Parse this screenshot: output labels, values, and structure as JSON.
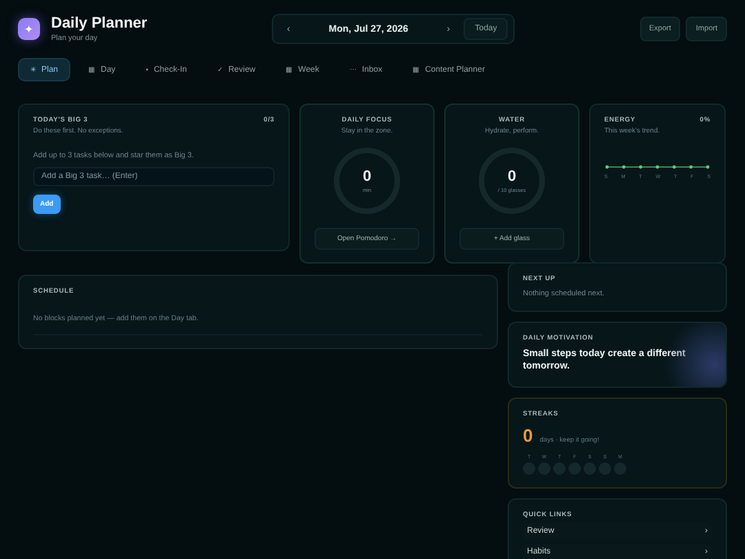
{
  "header": {
    "logo_glyph": "✦",
    "title": "Daily Planner",
    "subtitle": "Plan your day",
    "date_nav": {
      "prev": "‹",
      "date": "Mon, Jul 27, 2026",
      "next": "›",
      "today": "Today"
    },
    "actions": [
      "Export",
      "Import"
    ]
  },
  "tabs": [
    {
      "icon": "✳",
      "label": "Plan",
      "selected": true
    },
    {
      "icon": "▦",
      "label": "Day",
      "selected": false
    },
    {
      "icon": "•",
      "label": "Check-In",
      "selected": false
    },
    {
      "icon": "✓",
      "label": "Review",
      "selected": false
    },
    {
      "icon": "▦",
      "label": "Week",
      "selected": false
    },
    {
      "icon": "⋯",
      "label": "Inbox",
      "selected": false
    },
    {
      "icon": "▦",
      "label": "Content Planner",
      "selected": false
    }
  ],
  "big3": {
    "title": "TODAY'S BIG 3",
    "count": "0/3",
    "subtitle": "Do these first. No exceptions.",
    "hint": "Add up to 3 tasks below and star them as Big 3.",
    "input_placeholder": "Add a Big 3 task… (Enter)",
    "add_button": "Add"
  },
  "focus": {
    "title": "DAILY FOCUS",
    "subtitle": "Stay in the zone.",
    "value": "0",
    "unit": "min",
    "button": "Open Pomodoro →"
  },
  "water": {
    "title": "WATER",
    "subtitle": "Hydrate, perform.",
    "value": "0",
    "unit": "/ 10 glasses",
    "button": "+ Add glass"
  },
  "energy": {
    "title": "ENERGY",
    "percent": "0%",
    "subtitle": "This week's trend.",
    "days": [
      "S",
      "M",
      "T",
      "W",
      "T",
      "F",
      "S"
    ]
  },
  "schedule": {
    "title": "SCHEDULE",
    "empty": "No blocks planned yet — add them on the Day tab."
  },
  "next_up": {
    "title": "NEXT UP",
    "text": "Nothing scheduled next."
  },
  "motivation": {
    "title": "DAILY MOTIVATION",
    "quote": "Small steps today create a different tomorrow."
  },
  "streaks": {
    "title": "STREAKS",
    "value": "0",
    "caption": "days · keep it going!",
    "days": [
      {
        "label": "T",
        "done": false
      },
      {
        "label": "W",
        "done": false
      },
      {
        "label": "T",
        "done": false
      },
      {
        "label": "F",
        "done": false
      },
      {
        "label": "S",
        "done": false
      },
      {
        "label": "S",
        "done": false
      },
      {
        "label": "M",
        "done": false
      }
    ]
  },
  "quick_links": {
    "title": "QUICK LINKS",
    "items": [
      {
        "label": "Review",
        "chevron": "›"
      },
      {
        "label": "Habits",
        "chevron": "›"
      }
    ]
  }
}
